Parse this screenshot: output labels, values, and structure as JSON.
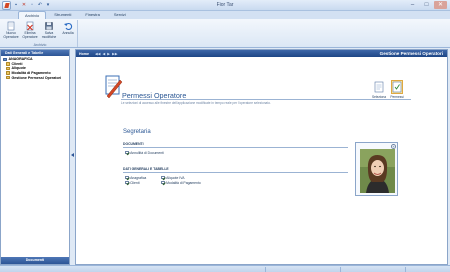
{
  "window": {
    "title": "Fior Tar",
    "controls": [
      "minimize",
      "maximize",
      "close"
    ]
  },
  "quick_access": [
    {
      "icon": "save-icon",
      "glyph": "▪"
    },
    {
      "icon": "delete-icon",
      "glyph": "✕"
    },
    {
      "icon": "print-icon",
      "glyph": "▫"
    },
    {
      "icon": "undo-icon",
      "glyph": "↶"
    },
    {
      "icon": "customize-icon",
      "glyph": "▾"
    }
  ],
  "ribbon": {
    "tabs": [
      "Archivio",
      "Strumenti",
      "Finestra",
      "Servizi"
    ],
    "active_tab": "Archivio",
    "group_label": "Archivio",
    "buttons": [
      {
        "label": "Nuovo Operatore",
        "icon": "new-document-icon"
      },
      {
        "label": "Elimina Operatore",
        "icon": "delete-document-icon"
      },
      {
        "label": "Salva modifiche",
        "icon": "save-icon"
      },
      {
        "label": "Annulla",
        "icon": "undo-icon"
      }
    ]
  },
  "left_panel": {
    "header": "Dati Generali e Tabelle",
    "footer": "Documenti",
    "tree": [
      {
        "label": "ANAGRAFICA",
        "level": 0
      },
      {
        "label": "Clienti",
        "level": 1
      },
      {
        "label": "Aliquote",
        "level": 1
      },
      {
        "label": "Modalità di Pagamento",
        "level": 1
      },
      {
        "label": "Gestione Permessi Operatori",
        "level": 1
      }
    ]
  },
  "main": {
    "home_label": "Home",
    "nav_glyphs": [
      "◀◀",
      "◀",
      "▶",
      "▶▶"
    ],
    "header_title": "Gestione Permessi Operatori",
    "page_title": "Permessi Operatore",
    "page_description": "Le selezioni di accesso alle finestre dell'applicazione modificate in tempo reale per l'operatore selezionato.",
    "tools": [
      {
        "label": "Seleziona",
        "icon": "select-icon"
      },
      {
        "label": "Permessi",
        "icon": "permissions-icon"
      }
    ],
    "operator_name": "Segretaria",
    "documenti": {
      "label": "DOCUMENTI",
      "items": [
        {
          "label": "Annullità di Documenti",
          "checked": true
        }
      ]
    },
    "dati_generali": {
      "label": "DATI GENERALI E TABELLE",
      "items": [
        {
          "label": "Anagrafica",
          "checked": true
        },
        {
          "label": "Aliquote IVA",
          "checked": true
        },
        {
          "label": "Clienti",
          "checked": true
        },
        {
          "label": "Modalità di Pagamento",
          "checked": true
        }
      ]
    },
    "photo_add_glyph": "+"
  }
}
